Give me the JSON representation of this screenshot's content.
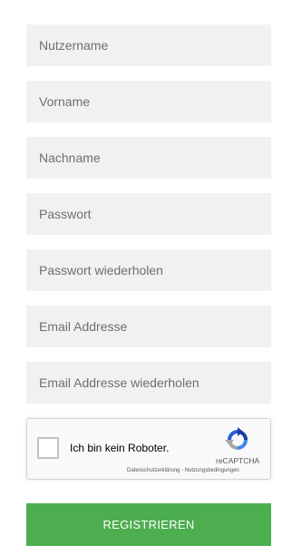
{
  "form": {
    "fields": [
      {
        "placeholder": "Nutzername",
        "value": ""
      },
      {
        "placeholder": "Vorname",
        "value": ""
      },
      {
        "placeholder": "Nachname",
        "value": ""
      },
      {
        "placeholder": "Passwort",
        "value": ""
      },
      {
        "placeholder": "Passwort wiederholen",
        "value": ""
      },
      {
        "placeholder": "Email Addresse",
        "value": ""
      },
      {
        "placeholder": "Email Addresse wiederholen",
        "value": ""
      }
    ],
    "submit_label": "REGISTRIEREN",
    "submit_color": "#4cae4f",
    "field_background": "#f1f1f1"
  },
  "captcha": {
    "label": "Ich bin kein Roboter.",
    "checked": false,
    "brand": "reCAPTCHA",
    "privacy_link": "Datenschutzerklärung",
    "separator": " - ",
    "terms_link": "Nutzungsbedingungen",
    "logo_icon": "recaptcha-logo-icon"
  }
}
